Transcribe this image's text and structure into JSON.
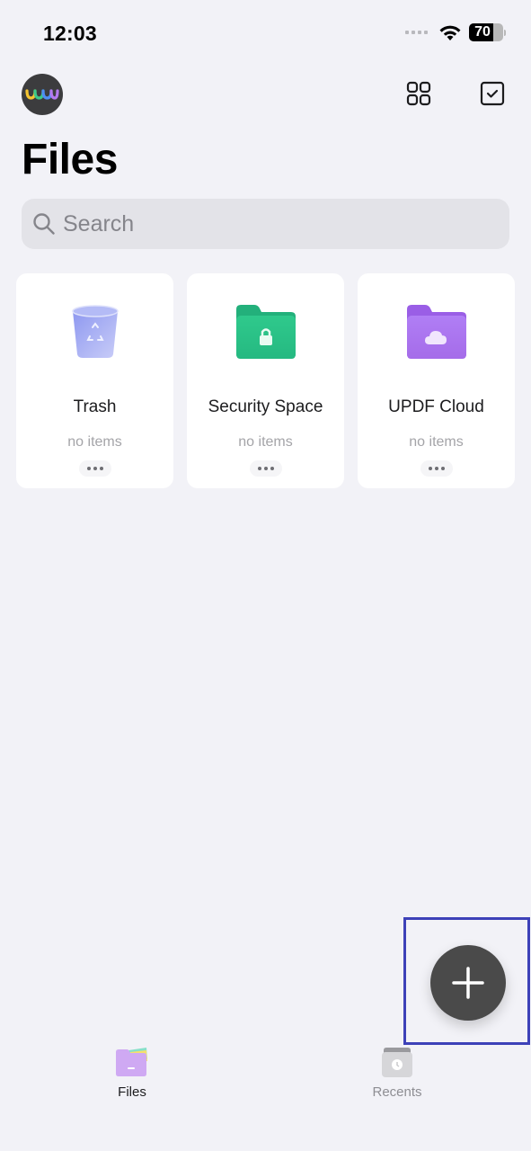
{
  "status_bar": {
    "time": "12:03",
    "battery_level": "70",
    "battery_fraction": 0.7,
    "icons": [
      "signal-dots-icon",
      "wifi-icon",
      "battery-icon"
    ]
  },
  "header": {
    "avatar": "app-logo-avatar",
    "actions": [
      {
        "name": "grid-view-button",
        "icon": "grid-icon"
      },
      {
        "name": "select-button",
        "icon": "checkbox-icon"
      }
    ]
  },
  "page": {
    "title": "Files"
  },
  "search": {
    "placeholder": "Search",
    "value": ""
  },
  "cards": [
    {
      "title": "Trash",
      "subtitle": "no items",
      "icon": "trash-icon",
      "color": "#9ea6f3"
    },
    {
      "title": "Security Space",
      "subtitle": "no items",
      "icon": "lock-folder-icon",
      "color": "#2bc48a"
    },
    {
      "title": "UPDF Cloud",
      "subtitle": "no items",
      "icon": "cloud-folder-icon",
      "color": "#a96ff0"
    }
  ],
  "fab": {
    "icon": "plus-icon",
    "color": "#4a4a4a",
    "highlight_color": "#3d41b8"
  },
  "tab_bar": {
    "items": [
      {
        "label": "Files",
        "icon": "files-folder-icon",
        "active": true
      },
      {
        "label": "Recents",
        "icon": "recents-clock-icon",
        "active": false
      }
    ]
  }
}
